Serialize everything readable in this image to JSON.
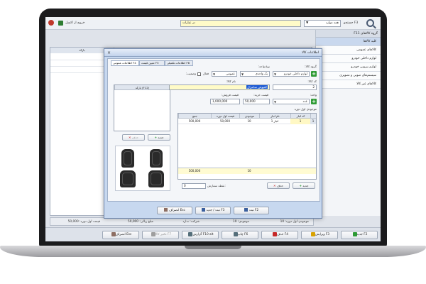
{
  "topbar": {
    "title_right": "جستجو F3",
    "search_combo": "همه موارد",
    "search_field": "در عبارات",
    "close_label": "خروج از اکسل"
  },
  "sidebar": {
    "header": "گروه کالاهای F11",
    "items": [
      {
        "label": "کلیه کالاها"
      },
      {
        "label": "کالاهای عمومی"
      },
      {
        "label": "لوازم داخلی خودرو"
      },
      {
        "label": "لوازم بیرونی خودرو"
      },
      {
        "label": "سیستم‌های صوتی و تصویری"
      },
      {
        "label": "کالاهای غیر کالا"
      }
    ]
  },
  "background_grid": {
    "headers": [
      "بارکد"
    ]
  },
  "summary": {
    "items": [
      "موجودی اول دوره: 10",
      "موجودی: 10",
      "شرکت: ندارد",
      "مبلغ ریالی: 50,000",
      "قیمت اول دوره: 50,000"
    ]
  },
  "bottom_buttons": [
    {
      "label": "جدید F2",
      "color": "#2e9b35"
    },
    {
      "label": "ویرایش F3",
      "color": "#d9a200"
    },
    {
      "label": "حذف F4",
      "color": "#c62828"
    },
    {
      "label": "چاپ F6",
      "color": "#546e7a"
    },
    {
      "label": "گزارش F10 alt",
      "color": "#546e7a"
    },
    {
      "label": "تکثیر کالا F7",
      "color": "#9e9e9e"
    },
    {
      "label": "انصراف Esc",
      "color": "#8d6e63"
    }
  ],
  "dialog": {
    "title": "اطلاعات کالا",
    "tabs": [
      "اطلاعات عمومی F4",
      "تعیین قیمت F5",
      "اطلاعات تکمیلی F6"
    ],
    "fields": {
      "group_label": "گروه کالا:",
      "group_value": "لوازم داخلی خودرو",
      "unit_type_label": "نوع واحد:",
      "unit_type_value": "یک واحدی",
      "category_value": "عمومی",
      "status_label": "وضعیت:",
      "status_value": "فعال",
      "code_label": "کد کالا:",
      "code_value": "2",
      "name_label": "نام کالا:",
      "name_value": "کفپوش سانترال",
      "unit_label": "واحد:",
      "unit_value": "عدد",
      "buy_price_label": "قیمت خرید:",
      "buy_price_value": "50,000",
      "sell_price_label": "قیمت فروش:",
      "sell_price_value": "1,000,000",
      "opening_label": "موجودی اول دوره"
    },
    "barcode_grid": {
      "header": "بارکد (F12)",
      "new_btn": "جدید",
      "delete_btn": "حذف"
    },
    "stock_grid": {
      "headers": [
        "کد انبار",
        "نام انبار",
        "موجودی",
        "قیمت اول دوره",
        "جمع"
      ],
      "rows": [
        {
          "idx": "1",
          "code": "1",
          "name": "انبار 1",
          "qty": "10",
          "price": "50,000",
          "total": "500,000"
        }
      ],
      "footer_qty": "10",
      "footer_total": "500,000",
      "order_point_label": "نقطه سفارش:",
      "order_point_value": "0",
      "new_btn": "جدید",
      "delete_btn": "حذف"
    },
    "footer": {
      "save": "ثبت F2",
      "save_new": "ثبت / جدید F3",
      "cancel": "انصراف Esc"
    }
  }
}
